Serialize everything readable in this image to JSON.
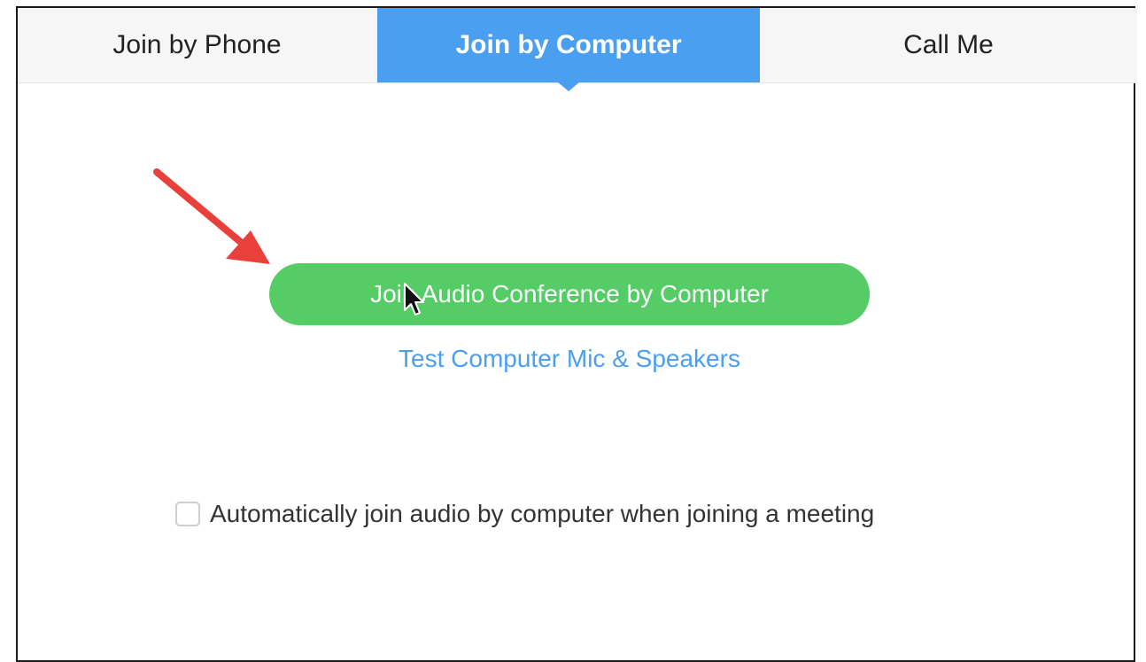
{
  "tabs": [
    {
      "label": "Join by Phone",
      "active": false
    },
    {
      "label": "Join by Computer",
      "active": true
    },
    {
      "label": "Call Me",
      "active": false
    }
  ],
  "main": {
    "join_button_label": "Join Audio Conference by Computer",
    "test_link_label": "Test Computer Mic & Speakers",
    "auto_join_label": "Automatically join audio by computer when joining a meeting",
    "auto_join_checked": false
  },
  "annotation": {
    "arrow_color": "#e8413c",
    "cursor_icon": "mouse-pointer-icon"
  },
  "colors": {
    "accent_blue": "#4b9ff0",
    "button_green": "#55cc66"
  }
}
